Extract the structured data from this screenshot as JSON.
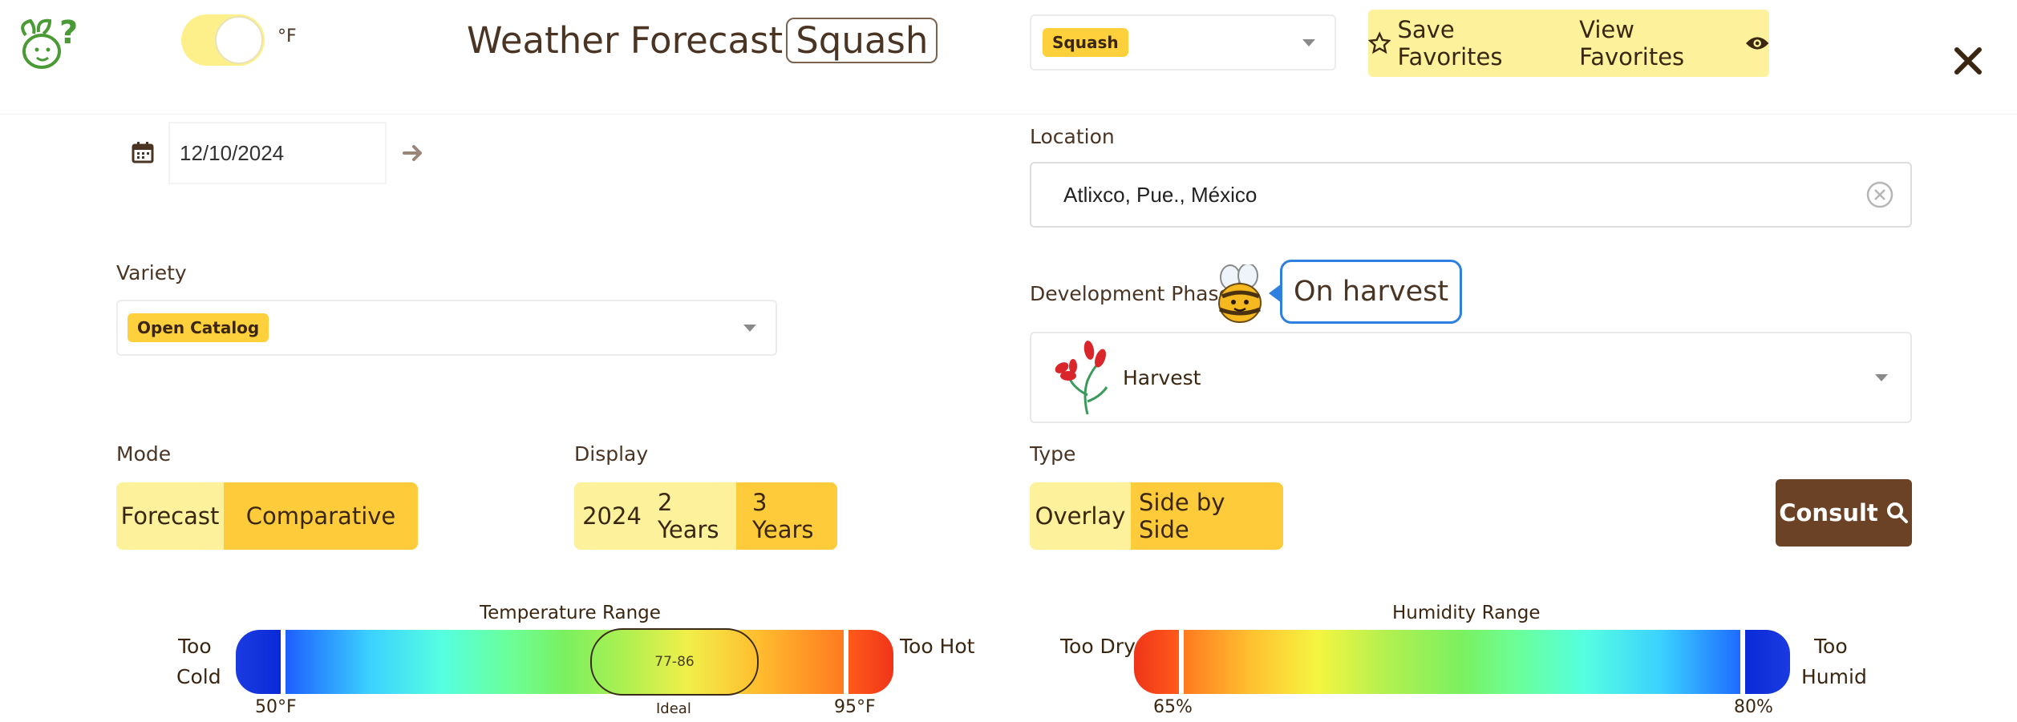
{
  "header": {
    "help_icon": "bee-question-icon",
    "unit_label": "°F",
    "title": "Weather Forecast",
    "crop_badge": "Squash",
    "crop_select": "Squash",
    "save_favorites": "Save Favorites",
    "view_favorites": "View Favorites",
    "close_icon": "close-icon"
  },
  "date": {
    "value": "12/10/2024"
  },
  "location": {
    "label": "Location",
    "value": "Atlixco, Pue., México"
  },
  "variety": {
    "label": "Variety",
    "value": "Open Catalog"
  },
  "development": {
    "label": "Development Phase",
    "bubble": "On harvest",
    "value": "Harvest"
  },
  "mode": {
    "label": "Mode",
    "options": [
      "Forecast",
      "Comparative"
    ],
    "selected": "Comparative"
  },
  "display": {
    "label": "Display",
    "options": [
      "2024",
      "2 Years",
      "3 Years"
    ],
    "selected": "3 Years"
  },
  "type": {
    "label": "Type",
    "options": [
      "Overlay",
      "Side by Side"
    ],
    "selected": "Side by Side"
  },
  "consult": {
    "label": "Consult"
  },
  "temperature": {
    "title": "Temperature Range",
    "left_label_1": "Too",
    "left_label_2": "Cold",
    "right_label": "Too Hot",
    "min": "50°F",
    "max": "95°F",
    "ideal_range": "77-86",
    "ideal_label": "Ideal"
  },
  "humidity": {
    "title": "Humidity Range",
    "left_label": "Too Dry",
    "right_label_1": "Too",
    "right_label_2": "Humid",
    "min": "65%",
    "max": "80%"
  },
  "colors": {
    "accent_yellow": "#fecc3a",
    "light_yellow": "#fdf29b",
    "brown": "#6b4226",
    "blue_bubble": "#2d7fe0"
  }
}
